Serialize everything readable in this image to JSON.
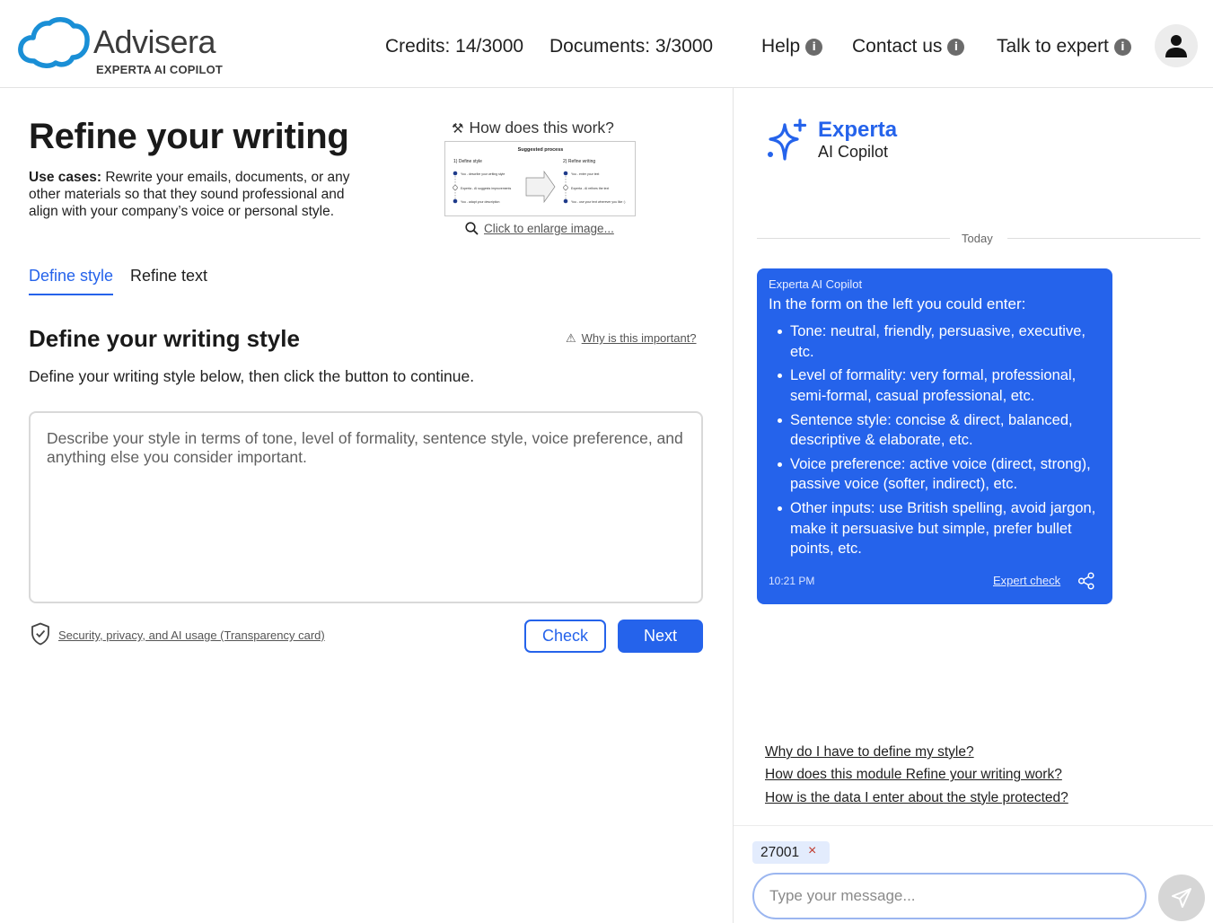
{
  "header": {
    "logo_name": "Advisera",
    "logo_sub": "EXPERTA AI COPILOT",
    "credits": "Credits: 14/3000",
    "documents": "Documents: 3/3000",
    "help": "Help",
    "contact": "Contact us",
    "talk": "Talk to expert",
    "info_glyph": "i",
    "avatar_icon": "user-icon"
  },
  "main": {
    "title": "Refine your writing",
    "use_cases_label": "Use cases:",
    "use_cases_text": " Rewrite your emails, documents, or any other materials so that they sound professional and align with your company’s voice or personal style.",
    "how_title": "How does this work?",
    "diagram": {
      "heading": "Suggested process",
      "col1_title": "1) Define style",
      "col1_steps": [
        "You - describe your writing style",
        "Experta - AI suggests improvements",
        "You - adapt your description"
      ],
      "col2_title": "2) Refine writing",
      "col2_steps": [
        "You - enter your text",
        "Experta - AI refines the text",
        "You - use your text wherever you like :)"
      ]
    },
    "enlarge": "Click to enlarge image...",
    "tabs": [
      {
        "label": "Define style",
        "active": true
      },
      {
        "label": "Refine text",
        "active": false
      }
    ],
    "section_title": "Define your writing style",
    "why_link": "Why is this important?",
    "instructions": "Define your writing style below, then click the button to continue.",
    "style_placeholder": "Describe your style in terms of tone, level of formality, sentence style, voice preference, and anything else you consider important.",
    "security_link": "Security, privacy, and AI usage (Transparency card)",
    "check_label": "Check",
    "next_label": "Next"
  },
  "copilot": {
    "name": "Experta",
    "sub": "AI Copilot",
    "today": "Today",
    "message": {
      "sender": "Experta AI Copilot",
      "intro": "In the form on the left you could enter:",
      "items": [
        "Tone: neutral, friendly, persuasive, executive, etc.",
        "Level of formality: very formal, professional, semi-formal, casual professional, etc.",
        "Sentence style: concise & direct, balanced, descriptive & elaborate, etc.",
        "Voice preference: active voice (direct, strong), passive voice (softer, indirect), etc.",
        "Other inputs: use British spelling, avoid jargon, make it persuasive but simple, prefer bullet points, etc."
      ],
      "time": "10:21 PM",
      "expert_check": "Expert check"
    },
    "suggestions": [
      "Why do I have to define my style?",
      "How does this module Refine your writing work?",
      "How is the data I enter about the style protected?"
    ],
    "chip_value": "27001",
    "chip_remove": "×",
    "input_placeholder": "Type your message..."
  },
  "colors": {
    "accent": "#2563eb",
    "logo_cloud": "#1a8fd6",
    "chip_bg": "#e3ecfd",
    "send_bg": "#d6d6d6"
  }
}
